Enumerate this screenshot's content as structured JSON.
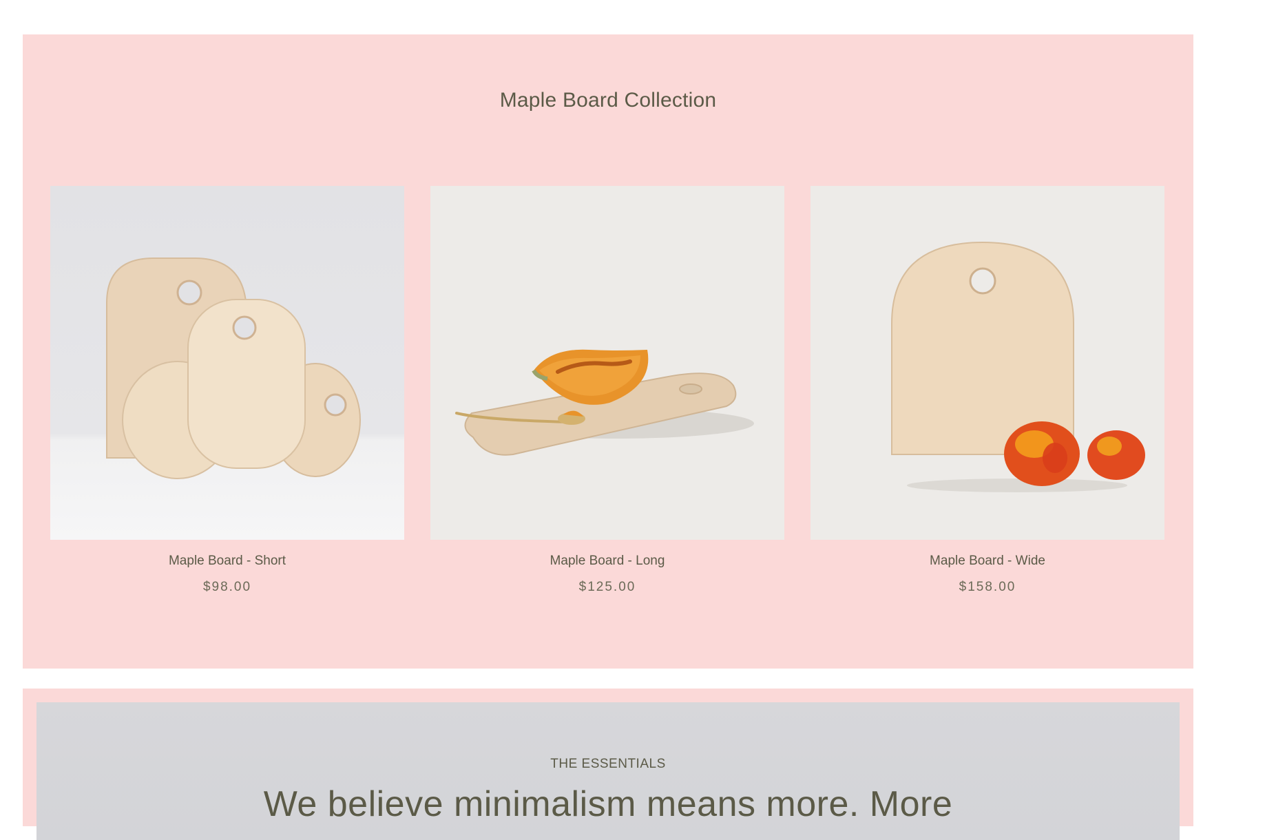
{
  "collection": {
    "title": "Maple Board Collection",
    "products": [
      {
        "name": "Maple Board - Short",
        "price": "$98.00",
        "image": "maple-boards-stack-photo"
      },
      {
        "name": "Maple Board - Long",
        "price": "$125.00",
        "image": "maple-board-long-with-melon-photo"
      },
      {
        "name": "Maple Board - Wide",
        "price": "$158.00",
        "image": "maple-board-wide-with-tomatoes-photo"
      }
    ]
  },
  "essentials": {
    "kicker": "THE ESSENTIALS",
    "headline": "We believe minimalism means more. More"
  },
  "colors": {
    "section_background": "#fbd9d8",
    "text": "#5b5a47",
    "photo_background_short": "#e3e3e6",
    "photo_background_long": "#edebe8",
    "photo_background_wide": "#edebe8"
  }
}
